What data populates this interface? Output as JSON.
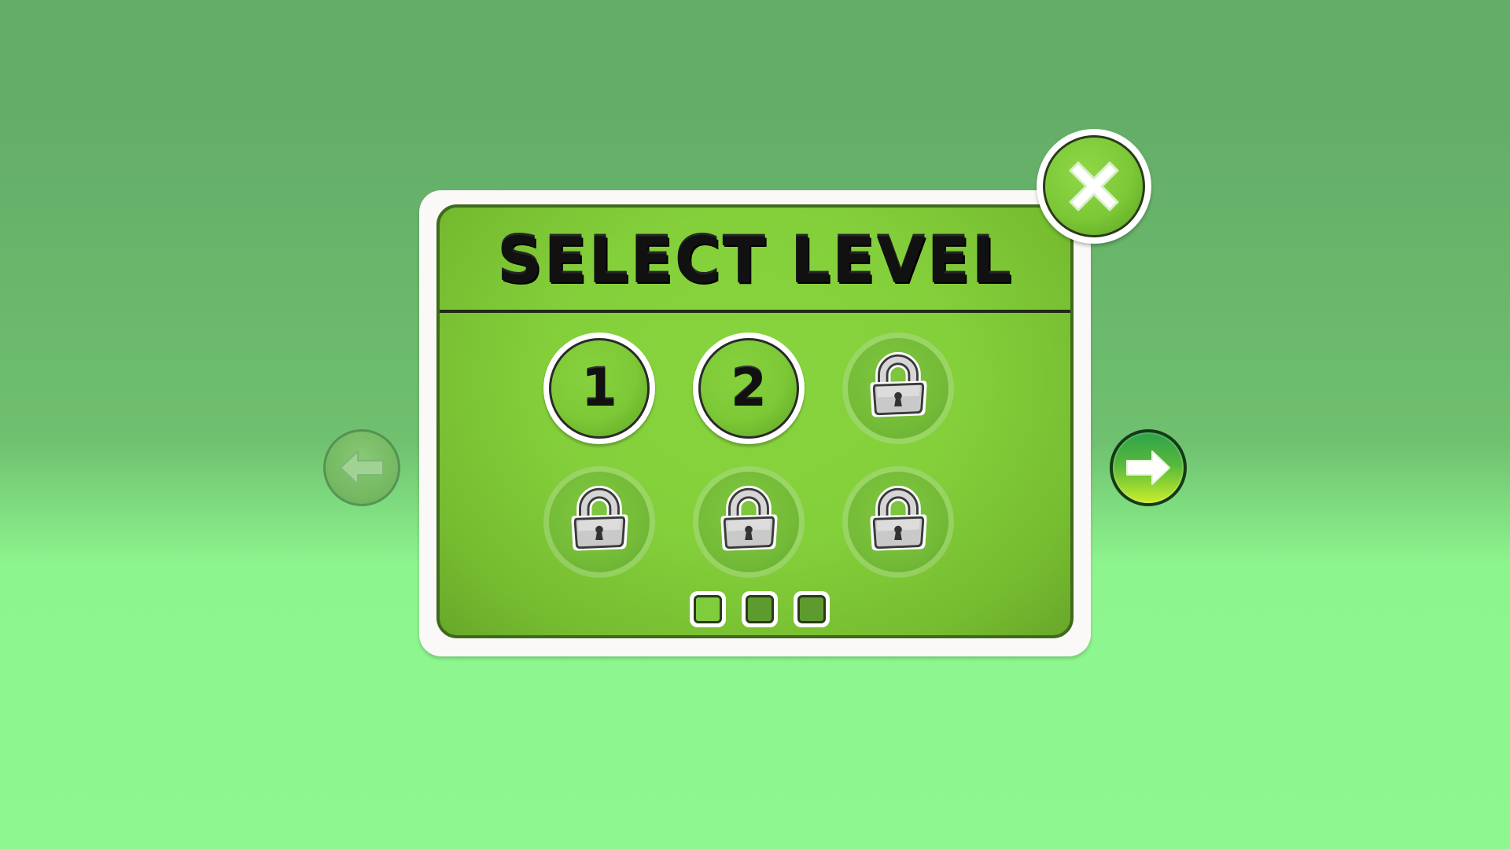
{
  "dialog": {
    "title": "SELECT LEVEL",
    "close_icon": "close-x-icon"
  },
  "levels": [
    {
      "number": "1",
      "state": "unlocked"
    },
    {
      "number": "2",
      "state": "unlocked"
    },
    {
      "number": "",
      "state": "locked",
      "icon": "padlock-icon"
    },
    {
      "number": "",
      "state": "locked",
      "icon": "padlock-icon"
    },
    {
      "number": "",
      "state": "locked",
      "icon": "padlock-icon"
    },
    {
      "number": "",
      "state": "locked",
      "icon": "padlock-icon"
    }
  ],
  "pagination": {
    "pages": 3,
    "current_page": 1
  },
  "navigation": {
    "prev_icon": "arrow-left-icon",
    "prev_enabled": false,
    "next_icon": "arrow-right-icon",
    "next_enabled": true
  },
  "colors": {
    "background_top": "#64ad68",
    "background_bottom": "#8ff78f",
    "panel_green": "#84d03b",
    "panel_frame": "#fbf8f8",
    "locked_disc": "#74bb38",
    "next_arrow_top": "#2fa34a",
    "next_arrow_bottom": "#c9ee2a"
  }
}
